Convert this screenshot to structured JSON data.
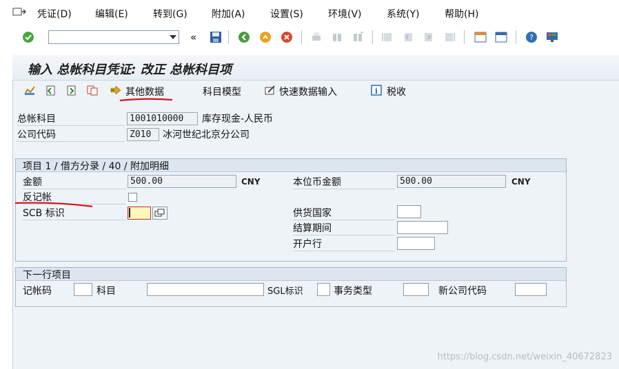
{
  "menu": [
    "凭证(D)",
    "编辑(E)",
    "转到(G)",
    "附加(A)",
    "设置(S)",
    "环境(V)",
    "系统(Y)",
    "帮助(H)"
  ],
  "toolbar": {
    "command_value": "",
    "nav_glyph": "«"
  },
  "title": "输入 总帐科目凭证: 改正 总帐科目项",
  "app_toolbar": {
    "other_data": "其他数据",
    "account_model": "科目模型",
    "fast_entry": "快速数据输入",
    "tax": "税收"
  },
  "header": {
    "gl_account_label": "总帐科目",
    "gl_account_value": "1001010000",
    "gl_account_desc": "库存现金-人民币",
    "company_code_label": "公司代码",
    "company_code_value": "Z010",
    "company_code_desc": "冰河世纪北京分公司"
  },
  "item_group": {
    "title": "项目 1 / 借方分录 / 40 / 附加明细",
    "amount_label": "金额",
    "amount_value": "500.00",
    "amount_currency": "CNY",
    "local_amount_label": "本位币金额",
    "local_amount_value": "500.00",
    "local_currency": "CNY",
    "reversal_label": "反记帐",
    "scb_label": "SCB 标识",
    "scb_value": "",
    "supplier_country_label": "供货国家",
    "supplier_country_value": "",
    "settlement_period_label": "结算期间",
    "settlement_period_value": "",
    "bank_label": "开户行",
    "bank_value": ""
  },
  "next_item": {
    "title": "下一行项目",
    "posting_key_label": "记帐码",
    "posting_key_value": "",
    "account_label": "科目",
    "account_value": "",
    "sgl_label": "SGL标识",
    "sgl_value": "",
    "transaction_type_label": "事务类型",
    "transaction_type_value": "",
    "new_company_code_label": "新公司代码",
    "new_company_code_value": ""
  },
  "watermark": "https://blog.csdn.net/weixin_40672823",
  "colors": {
    "accent_red": "#d4141c",
    "panel_bg": "#eef3f8"
  }
}
